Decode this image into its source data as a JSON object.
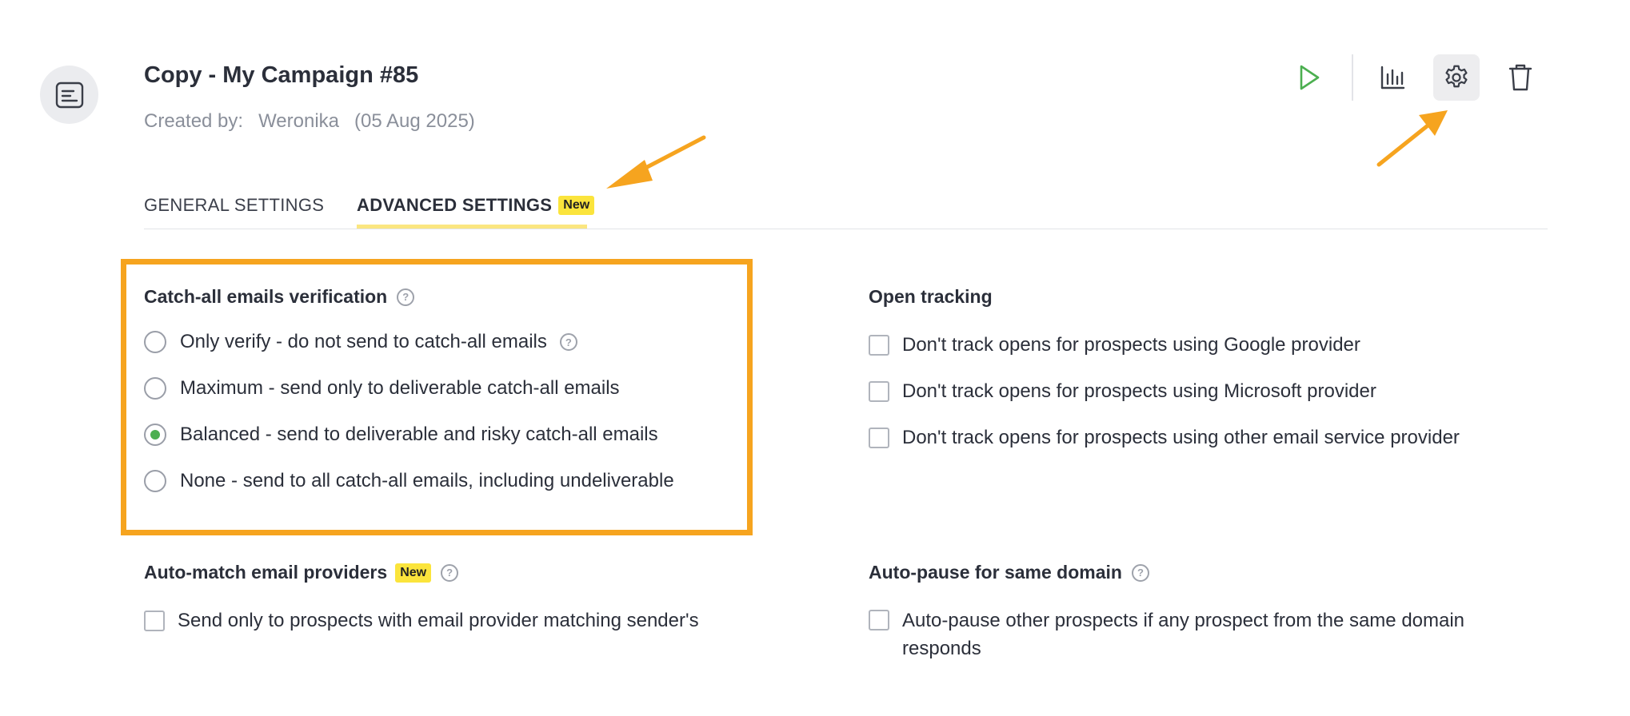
{
  "campaign": {
    "title": "Copy - My Campaign #85",
    "created_by_label": "Created by:",
    "author": "Weronika",
    "date": "(05 Aug 2025)"
  },
  "toolbar": {
    "icons": [
      "play-icon",
      "stats-icon",
      "settings-icon",
      "trash-icon"
    ],
    "active": "settings"
  },
  "tabs": [
    {
      "label": "GENERAL SETTINGS",
      "active": false
    },
    {
      "label": "ADVANCED SETTINGS",
      "badge": "New",
      "active": true
    }
  ],
  "catch_all": {
    "title": "Catch-all emails verification",
    "help": "?",
    "options": [
      {
        "label": "Only verify - do not send to catch-all emails",
        "selected": false,
        "help": "?"
      },
      {
        "label": "Maximum - send only to deliverable catch-all emails",
        "selected": false
      },
      {
        "label": "Balanced - send to deliverable and risky catch-all emails",
        "selected": true
      },
      {
        "label": "None - send to all catch-all emails, including undeliverable",
        "selected": false
      }
    ]
  },
  "open_tracking": {
    "title": "Open tracking",
    "options": [
      {
        "label": "Don't track opens for prospects using Google provider",
        "checked": false
      },
      {
        "label": "Don't track opens for prospects using Microsoft provider",
        "checked": false
      },
      {
        "label": "Don't track opens for prospects using other email service provider",
        "checked": false
      }
    ]
  },
  "auto_match": {
    "title": "Auto-match email providers",
    "badge": "New",
    "help": "?",
    "option": {
      "label": "Send only to prospects with email provider matching sender's",
      "checked": false
    }
  },
  "auto_pause": {
    "title": "Auto-pause for same domain",
    "help": "?",
    "option": {
      "label_line1": "Auto-pause other prospects if any prospect from the same domain",
      "label_line2": "responds",
      "checked": false
    }
  },
  "colors": {
    "accent_orange": "#f6a41f",
    "badge_yellow": "#fbe43c",
    "radio_selected": "#4caf50",
    "play_green": "#4caf50"
  }
}
